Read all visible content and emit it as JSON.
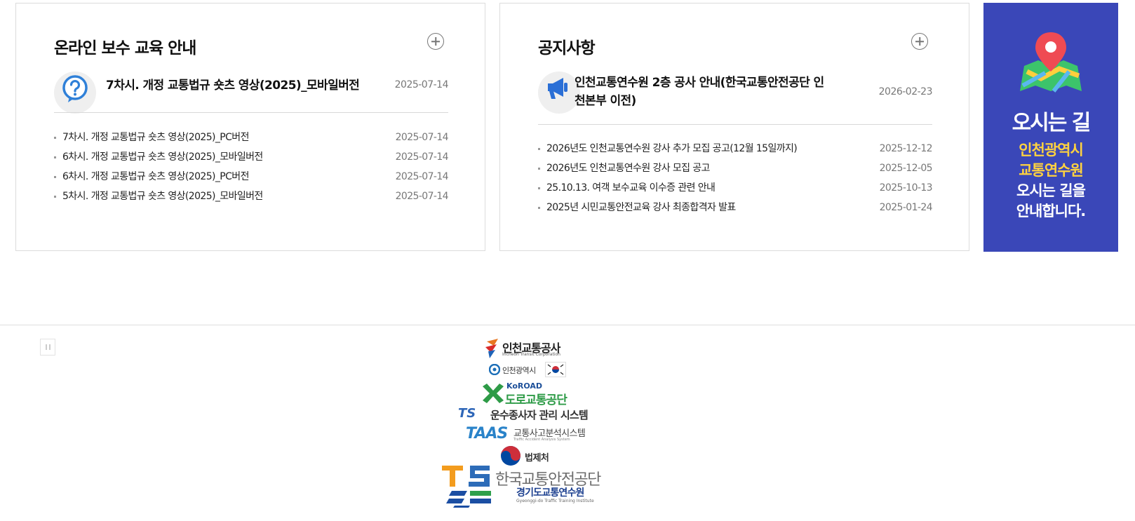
{
  "edu": {
    "title": "온라인 보수 교육 안내",
    "more_label": "더보기",
    "featured": {
      "title": "7차시. 개정 교통법규 숏츠 영상(2025)_모바일버전",
      "date": "2025-07-14",
      "icon": "question-icon"
    },
    "items": [
      {
        "title": "7차시. 개정 교통법규 숏츠 영상(2025)_PC버전",
        "date": "2025-07-14"
      },
      {
        "title": "6차시. 개정 교통법규 숏츠 영상(2025)_모바일버전",
        "date": "2025-07-14"
      },
      {
        "title": "6차시. 개정 교통법규 숏츠 영상(2025)_PC버전",
        "date": "2025-07-14"
      },
      {
        "title": "5차시. 개정 교통법규 숏츠 영상(2025)_모바일버전",
        "date": "2025-07-14"
      }
    ]
  },
  "notice": {
    "title": "공지사항",
    "featured": {
      "title": "인천교통연수원 2층 공사 안내(한국교통안전공단 인천본부 이전)",
      "date": "2026-02-23",
      "icon": "megaphone-icon"
    },
    "items": [
      {
        "title": "2026년도 인천교통연수원 강사 추가 모집 공고(12월 15일까지)",
        "date": "2025-12-12"
      },
      {
        "title": "2026년도 인천교통연수원 강사 모집 공고",
        "date": "2025-12-05"
      },
      {
        "title": "25.10.13. 여객 보수교육 이수증 관련 안내",
        "date": "2025-10-13"
      },
      {
        "title": "2025년 시민교통안전교육 강사 최종합격자 발표",
        "date": "2025-01-24"
      }
    ]
  },
  "directions": {
    "title": "오시는 길",
    "line1": "인천광역시",
    "line2": "교통연수원",
    "line3": "오시는 길을",
    "line4": "안내합니다.",
    "icon": "map-pin-icon",
    "bg_color": "#3a47b8",
    "highlight_color": "#ffd23f"
  },
  "footer": {
    "logos": {
      "incheon_transit": {
        "name": "인천교통공사",
        "sub": "Incheon Transit Corporation"
      },
      "incheon_city": {
        "name": "인천광역시"
      },
      "koroad": {
        "brand": "KoROAD",
        "name": "도로교통공단"
      },
      "ts_driver": {
        "brand": "TS",
        "name": "운수종사자 관리 시스템"
      },
      "taas": {
        "brand": "TAAS",
        "name": "교통사고분석시스템",
        "sub": "Traffic Accident Analysis System"
      },
      "moleg": {
        "name": "법제처"
      },
      "ts_kotsa": {
        "brand": "TS",
        "name": "한국교통안전공단",
        "name2": "경기도교통연수원",
        "sub": "Gyeonggi-do Traffic Training Institute"
      }
    }
  }
}
